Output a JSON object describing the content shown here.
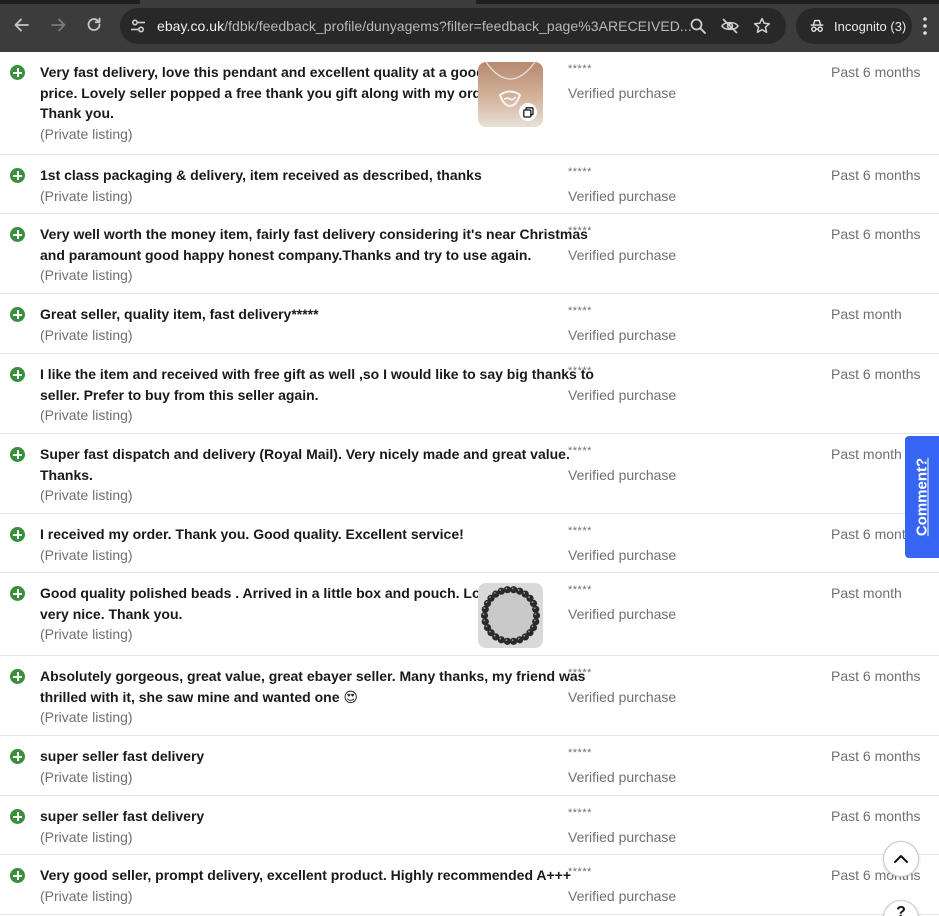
{
  "browser": {
    "url_domain": "ebay.co.uk",
    "url_path": "/fdbk/feedback_profile/dunyagems?filter=feedback_page%3ARECEIVED...",
    "incognito_label": "Incognito (3)"
  },
  "feedback": [
    {
      "comment_lines": [
        "Very fast delivery, love this pendant and excellent quality at a good",
        "price. Lovely seller popped a free thank you gift along with my order.",
        "Thank you."
      ],
      "listing": "(Private listing)",
      "rating": "*****",
      "verified": "Verified purchase",
      "when": "Past 6 months",
      "has_photo": true,
      "photo": "pendant"
    },
    {
      "comment_lines": [
        "1st class packaging & delivery, item received as described, thanks"
      ],
      "listing": "(Private listing)",
      "rating": "*****",
      "verified": "Verified purchase",
      "when": "Past 6 months"
    },
    {
      "comment_lines": [
        "Very well worth the money item, fairly fast delivery considering it's near Christmas",
        "and paramount good happy honest company.Thanks and try to use again."
      ],
      "listing": "(Private listing)",
      "rating": "*****",
      "verified": "Verified purchase",
      "when": "Past 6 months"
    },
    {
      "comment_lines": [
        "Great seller, quality item, fast delivery*****"
      ],
      "listing": "(Private listing)",
      "rating": "*****",
      "verified": "Verified purchase",
      "when": "Past month"
    },
    {
      "comment_lines": [
        "I like the item and received with free gift as well ,so I would like to say big thanks to",
        "seller. Prefer to buy from this seller again."
      ],
      "listing": "(Private listing)",
      "rating": "*****",
      "verified": "Verified purchase",
      "when": "Past 6 months"
    },
    {
      "comment_lines": [
        "Super fast dispatch and delivery (Royal Mail). Very nicely made and great value.",
        "Thanks."
      ],
      "listing": "(Private listing)",
      "rating": "*****",
      "verified": "Verified purchase",
      "when": "Past month"
    },
    {
      "comment_lines": [
        "I received my order. Thank you. Good quality. Excellent service!"
      ],
      "listing": "(Private listing)",
      "rating": "*****",
      "verified": "Verified purchase",
      "when": "Past 6 months"
    },
    {
      "comment_lines": [
        "Good quality polished beads . Arrived in a little box and pouch. Looks",
        "very nice. Thank you."
      ],
      "listing": "(Private listing)",
      "rating": "*****",
      "verified": "Verified purchase",
      "when": "Past month",
      "has_photo": true,
      "photo": "beads"
    },
    {
      "comment_lines": [
        "Absolutely gorgeous, great value, great ebayer seller. Many thanks, my friend was",
        "thrilled with it, she saw mine and wanted one 😍"
      ],
      "listing": "(Private listing)",
      "rating": "*****",
      "verified": "Verified purchase",
      "when": "Past 6 months"
    },
    {
      "comment_lines": [
        "super seller fast delivery"
      ],
      "listing": "(Private listing)",
      "rating": "*****",
      "verified": "Verified purchase",
      "when": "Past 6 months"
    },
    {
      "comment_lines": [
        "super seller fast delivery"
      ],
      "listing": "(Private listing)",
      "rating": "*****",
      "verified": "Verified purchase",
      "when": "Past 6 months"
    },
    {
      "comment_lines": [
        "Very good seller, prompt delivery, excellent product. Highly recommended A+++"
      ],
      "listing": "(Private listing)",
      "rating": "*****",
      "verified": "Verified purchase",
      "when": "Past 6 months"
    }
  ],
  "comment_tab_label": "Comment?",
  "help_label": "?",
  "colors": {
    "positive": "#3a8f3e",
    "accent": "#3665f3"
  }
}
